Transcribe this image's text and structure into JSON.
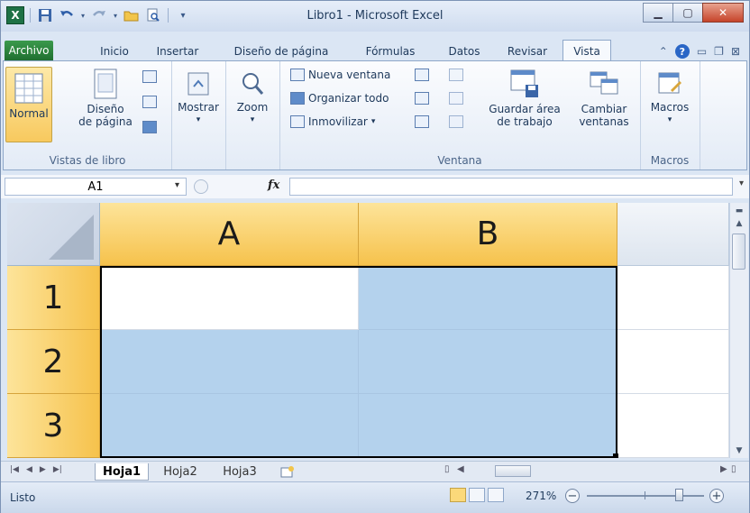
{
  "window": {
    "title": "Libro1 - Microsoft Excel",
    "app_icon": "excel-icon",
    "controls": [
      "minimize-icon",
      "maximize-icon",
      "close-icon"
    ]
  },
  "quick_access": {
    "items": [
      "save-icon",
      "undo-icon",
      "redo-icon",
      "open-icon",
      "print-preview-icon",
      "customize-icon"
    ]
  },
  "tabs": [
    {
      "label": "Archivo"
    },
    {
      "label": "Inicio"
    },
    {
      "label": "Insertar"
    },
    {
      "label": "Diseño de página"
    },
    {
      "label": "Fórmulas"
    },
    {
      "label": "Datos"
    },
    {
      "label": "Revisar"
    },
    {
      "label": "Vista",
      "active": true
    }
  ],
  "ribbon": {
    "groups": {
      "vistas_libro": {
        "label": "Vistas de libro",
        "normal": "Normal",
        "diseno": "Diseño\nde página"
      },
      "mostrar": {
        "label": "Mostrar"
      },
      "zoom": {
        "label": "Zoom"
      },
      "ventana": {
        "label": "Ventana",
        "nueva": "Nueva ventana",
        "organizar": "Organizar todo",
        "inmovilizar": "Inmovilizar",
        "guardar": "Guardar área\nde trabajo",
        "cambiar": "Cambiar\nventanas"
      },
      "macros": {
        "label": "Macros",
        "button": "Macros"
      }
    }
  },
  "formula_bar": {
    "name_box": "A1",
    "fx": "fx",
    "value": ""
  },
  "grid": {
    "columns": [
      "A",
      "B"
    ],
    "rows": [
      "1",
      "2",
      "3"
    ],
    "selection_color": "#b4d2ed",
    "header_highlight": "#f6c24c"
  },
  "sheets": {
    "tabs": [
      "Hoja1",
      "Hoja2",
      "Hoja3"
    ],
    "active": "Hoja1"
  },
  "status": {
    "text": "Listo",
    "zoom": "271%"
  }
}
